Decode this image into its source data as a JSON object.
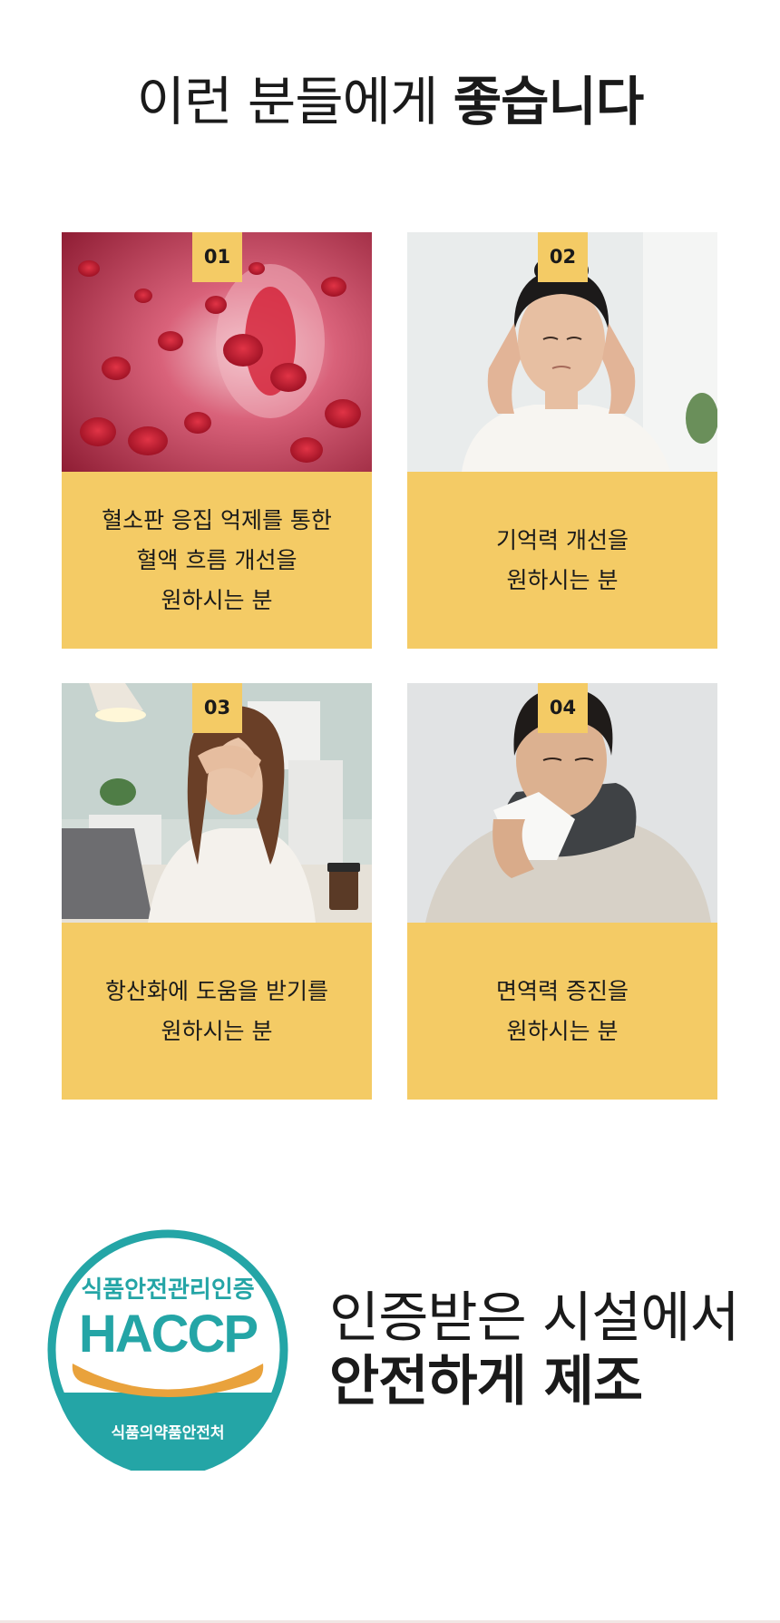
{
  "headline": {
    "light": "이런 분들에게 ",
    "bold": "좋습니다"
  },
  "cards": [
    {
      "number": "01",
      "caption": "혈소판 응집 억제를 통한\n혈액 흐름 개선을\n원하시는 분",
      "image": "red-blood-cells-image"
    },
    {
      "number": "02",
      "caption": "기억력 개선을\n원하시는 분",
      "image": "woman-headache-image"
    },
    {
      "number": "03",
      "caption": "항산화에 도움을 받기를\n원하시는 분",
      "image": "tired-office-woman-image"
    },
    {
      "number": "04",
      "caption": "면역력 증진을\n원하시는 분",
      "image": "man-with-cold-image"
    }
  ],
  "haccp": {
    "top_text": "식품안전관리인증",
    "mark": "HACCP",
    "bottom_text": "식품의약품안전처"
  },
  "certification": {
    "line1": "인증받은 시설에서",
    "line2": "안전하게 제조"
  },
  "colors": {
    "accent": "#f4cb65",
    "haccp_teal": "#24a5a6",
    "haccp_orange": "#e9a23c"
  }
}
